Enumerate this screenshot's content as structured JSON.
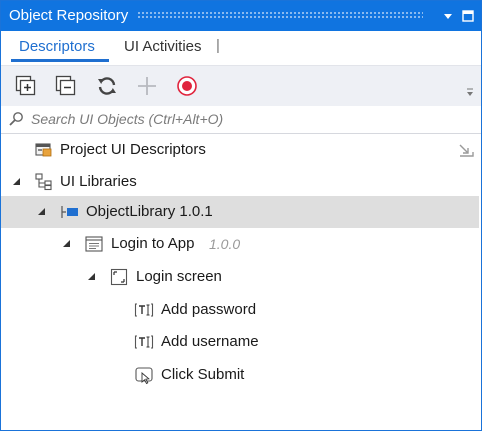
{
  "panel": {
    "title": "Object Repository"
  },
  "tabs": {
    "descriptors": "Descriptors",
    "ui_activities": "UI Activities",
    "separator": "|"
  },
  "search": {
    "placeholder": "Search UI Objects (Ctrl+Alt+O)"
  },
  "tree": {
    "project_descriptors": "Project UI Descriptors",
    "ui_libraries": "UI Libraries",
    "library": "ObjectLibrary 1.0.1",
    "app": {
      "name": "Login to App",
      "version": "1.0.0"
    },
    "screen": "Login screen",
    "elements": [
      "Add password",
      "Add username",
      "Click Submit"
    ]
  },
  "colors": {
    "accent": "#1074e0",
    "tab_active": "#1f6fd0",
    "toolbar_bg": "#eef0f5",
    "selection": "#dedede",
    "record": "#e0243d"
  }
}
